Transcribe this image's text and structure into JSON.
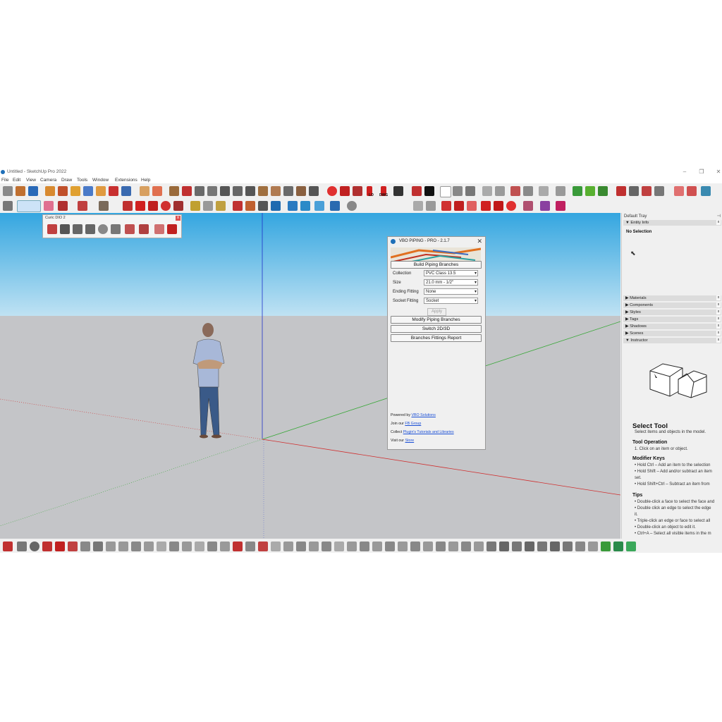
{
  "window": {
    "title": "Untitled - SketchUp Pro 2022",
    "controls": [
      "–",
      "❐",
      "✕"
    ]
  },
  "menu": [
    "File",
    "Edit",
    "View",
    "Camera",
    "Draw",
    "Tools",
    "Window",
    "Extensions",
    "Help"
  ],
  "toolbar_text": {
    "lo": "LO",
    "dwg": "DWG"
  },
  "floating_toolbar": {
    "title": "Curic DIO 2",
    "close": "x"
  },
  "dialog": {
    "title": "VBO PIPING - PRO - 2.1.7",
    "close": "✕",
    "build_button": "Build Piping Branches",
    "fields": [
      {
        "label": "Collection",
        "value": "PVC Class 13.5"
      },
      {
        "label": "Size",
        "value": "21.0 mm - 1/2\""
      },
      {
        "label": "Ending Fitting",
        "value": "None"
      },
      {
        "label": "Socket Fitting",
        "value": "Socket"
      }
    ],
    "apply": "Apply",
    "buttons": [
      "Modify Piping Branches",
      "Switch 2D/3D",
      "Branches Fittings Report"
    ],
    "footer": {
      "powered_prefix": "Powered by ",
      "powered_link": "VBO Solutions",
      "join_prefix": "Join our ",
      "join_link": "FB Group",
      "collect_prefix": "Collect ",
      "collect_link": "Plugin's Tutorials and Libraries",
      "visit_prefix": "Visit our ",
      "visit_link": "Store"
    }
  },
  "tray": {
    "title": "Default Tray",
    "entity_info": "Entity Info",
    "no_selection": "No Selection",
    "panels": [
      "Materials",
      "Components",
      "Styles",
      "Tags",
      "Shadows",
      "Scenes"
    ],
    "instructor": "Instructor",
    "instructor_content": {
      "heading": "Select Tool",
      "subheading": "Select items and objects in the model.",
      "op_title": "Tool Operation",
      "op_items": [
        "1. Click on an item or object."
      ],
      "mod_title": "Modifier Keys",
      "mod_items": [
        "• Hold Ctrl – Add an item to the selection",
        "• Hold Shift – Add and/or subtract an item",
        "  set.",
        "• Hold Shift+Ctrl – Subtract an item from"
      ],
      "tips_title": "Tips",
      "tips_items": [
        "• Double-click a face to select the face and",
        "• Double click an edge to select the edge",
        "  it.",
        "• Triple-click an edge or face to select all",
        "• Double-click an object to edit it.",
        "• Ctrl+A – Select all visible items in the m"
      ]
    }
  },
  "colors": {
    "sky_top": "#34a6e0",
    "ground": "#c4c5c8",
    "axis_red": "#d03030",
    "axis_green": "#3aa83a",
    "axis_blue": "#2030c8"
  }
}
